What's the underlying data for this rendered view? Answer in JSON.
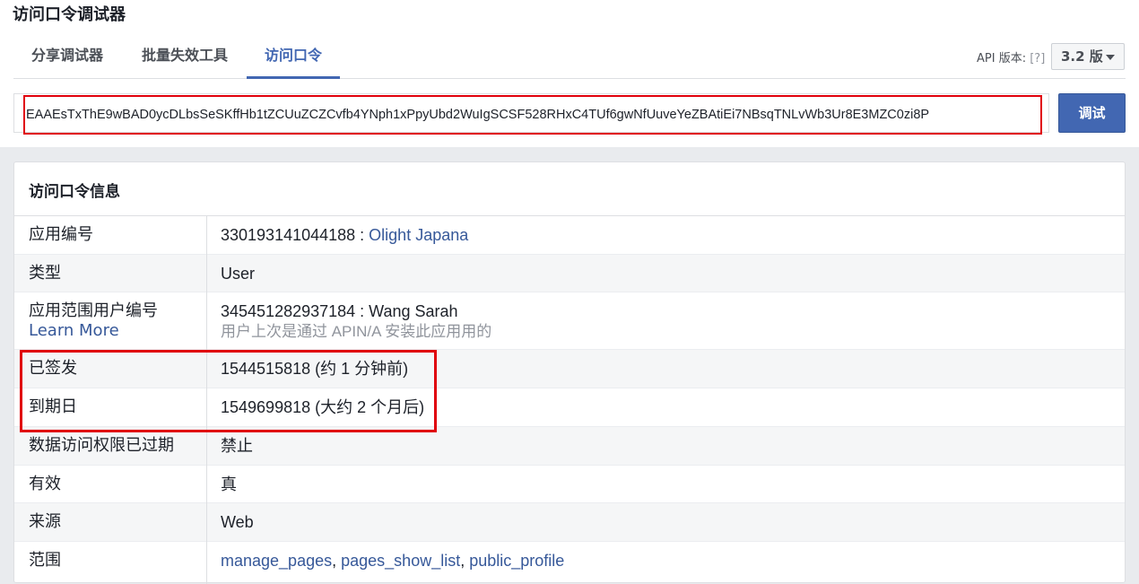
{
  "app": {
    "title": "访问口令调试器"
  },
  "tabs": [
    {
      "label": "分享调试器",
      "active": false
    },
    {
      "label": "批量失效工具",
      "active": false
    },
    {
      "label": "访问口令",
      "active": true
    }
  ],
  "api": {
    "label": "API 版本:",
    "help": "[?]",
    "selected": "3.2 版"
  },
  "token": {
    "value": "EAAEsTxThE9wBAD0ycDLbsSeSKffHb1tZCUuZCZCvfb4YNph1xPpyUbd2WuIgSCSF528RHxC4TUf6gwNfUuveYeZBAtiEi7NBsqTNLvWb3Ur8E3MZC0zi8P",
    "button": "调试"
  },
  "info": {
    "title": "访问口令信息",
    "rows": [
      {
        "label": "应用编号",
        "value_prefix": "330193141044188 : ",
        "value_link": "Olight Japana"
      },
      {
        "label": "类型",
        "value_link": "User"
      },
      {
        "label": "应用范围用户编号",
        "label_link": "Learn More",
        "value": "345451282937184 : Wang Sarah",
        "value_sub": "用户上次是通过 APIN/A 安装此应用用的"
      },
      {
        "label": "已签发",
        "value": "1544515818 (约 1 分钟前)"
      },
      {
        "label": "到期日",
        "value": "1549699818 (大约 2 个月后)"
      },
      {
        "label": "数据访问权限已过期",
        "value": "禁止"
      },
      {
        "label": "有效",
        "value": "真"
      },
      {
        "label": "来源",
        "value": "Web"
      },
      {
        "label": "范围",
        "scopes": [
          "manage_pages",
          "pages_show_list",
          "public_profile"
        ],
        "separator": ", "
      }
    ]
  },
  "colors": {
    "accent": "#4267b2",
    "link": "#365899",
    "highlight": "#e0000b"
  }
}
